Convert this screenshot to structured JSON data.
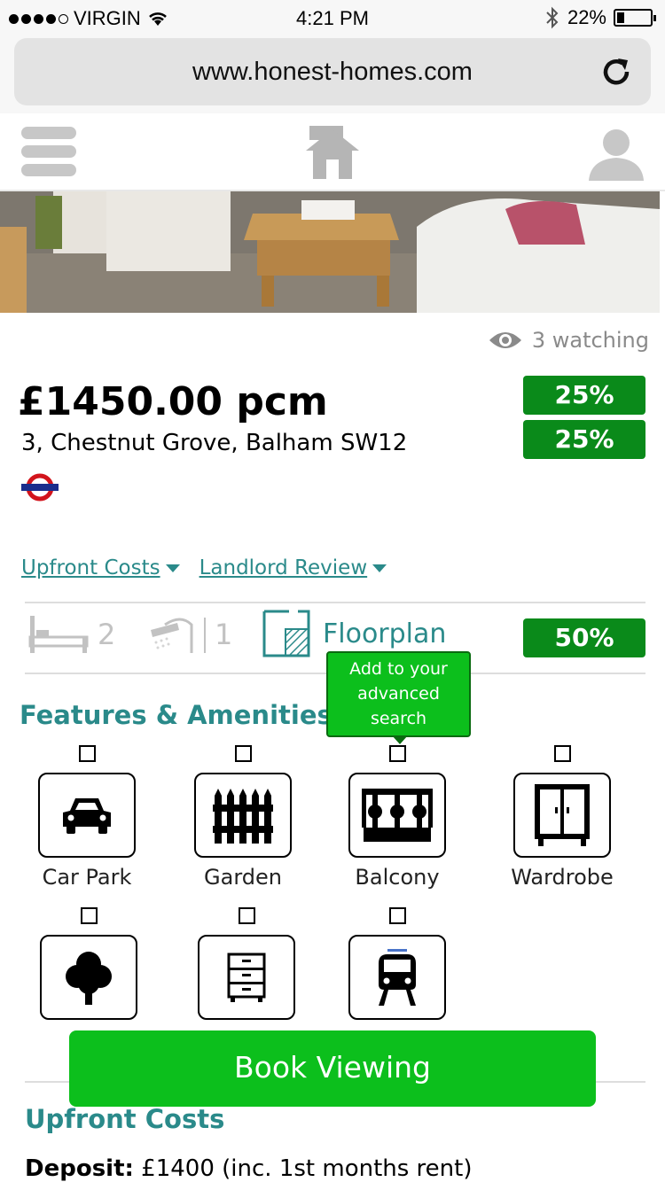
{
  "status_bar": {
    "carrier": "VIRGIN",
    "time": "4:21 PM",
    "battery": "22%"
  },
  "browser": {
    "url": "www.honest-homes.com"
  },
  "listing": {
    "watching": "3 watching",
    "price": "£1450.00 pcm",
    "address": "3, Chestnut Grove, Balham SW12",
    "badges": [
      "25%",
      "25%"
    ],
    "links": [
      "Upfront Costs",
      "Landlord Review"
    ],
    "bedrooms": "2",
    "bathrooms": "1",
    "floorplan_label": "Floorplan",
    "floorplan_badge": "50%"
  },
  "tooltip": {
    "line1": "Add to your",
    "line2": "advanced",
    "line3": "search"
  },
  "features": {
    "title": "Features & Amenities:",
    "items": [
      {
        "label": "Car Park",
        "icon": "car-icon"
      },
      {
        "label": "Garden",
        "icon": "fence-icon"
      },
      {
        "label": "Balcony",
        "icon": "balcony-icon"
      },
      {
        "label": "Wardrobe",
        "icon": "wardrobe-icon"
      },
      {
        "label": "",
        "icon": "tree-icon"
      },
      {
        "label": "",
        "icon": "drawers-icon"
      },
      {
        "label": "",
        "icon": "train-icon"
      }
    ]
  },
  "book_button": "Book Viewing",
  "upfront": {
    "title": "Upfront Costs",
    "deposit_label": "Deposit:",
    "deposit_value": " £1400 (inc. 1st months rent)"
  },
  "colors": {
    "accent_teal": "#2a8a8a",
    "badge_green": "#0a8a1a",
    "button_green": "#0cbf1c"
  }
}
